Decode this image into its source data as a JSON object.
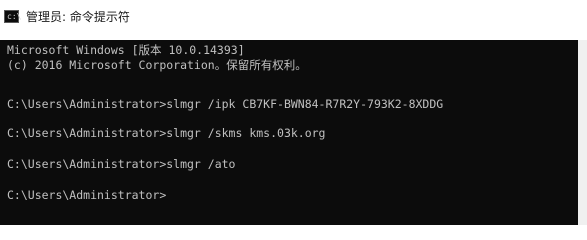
{
  "window": {
    "title": "管理员: 命令提示符",
    "icon": "console-icon"
  },
  "console": {
    "lines": [
      "Microsoft Windows [版本 10.0.14393]",
      "(c) 2016 Microsoft Corporation。保留所有权利。",
      "",
      "C:\\Users\\Administrator>slmgr /ipk CB7KF-BWN84-R7R2Y-793K2-8XDDG",
      "",
      "C:\\Users\\Administrator>slmgr /skms kms.03k.org",
      "",
      "C:\\Users\\Administrator>slmgr /ato",
      "",
      "C:\\Users\\Administrator>"
    ]
  }
}
